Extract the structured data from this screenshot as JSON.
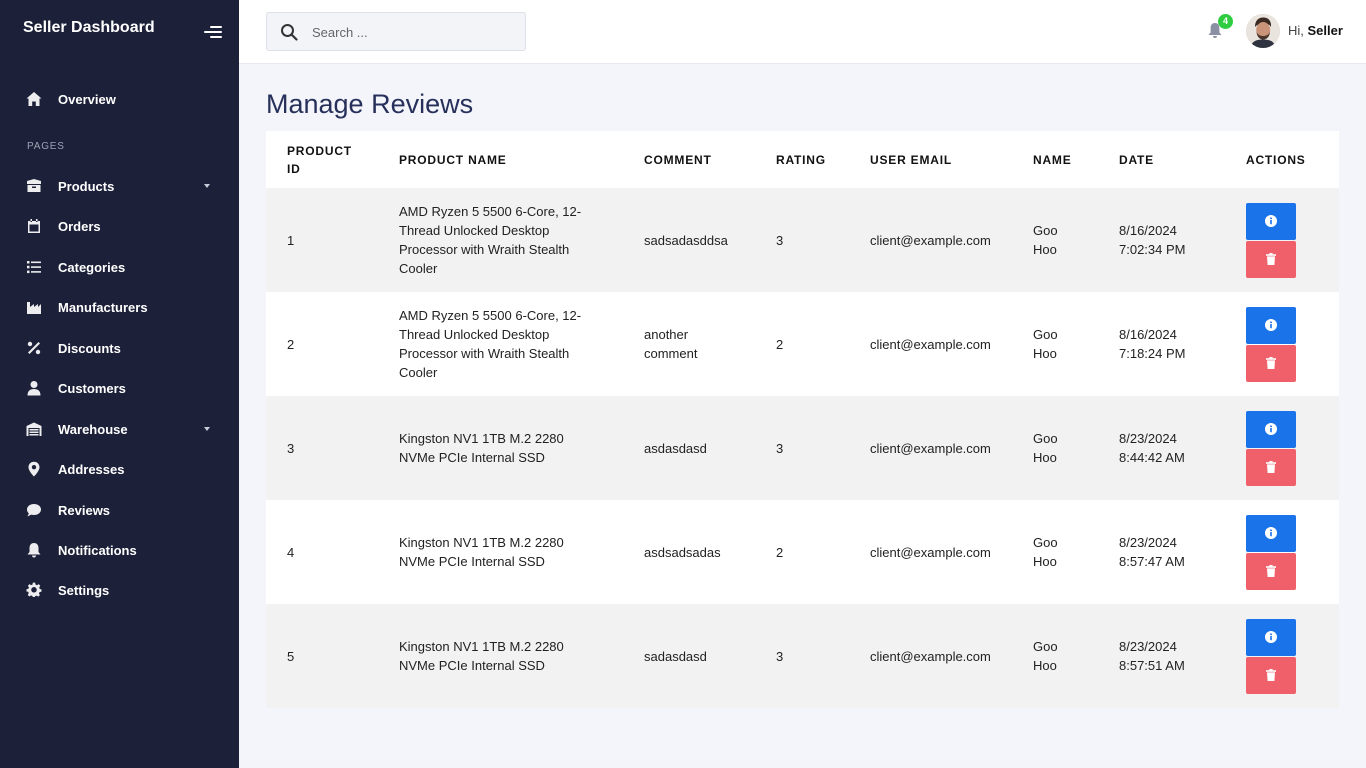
{
  "sidebar": {
    "brand": "Seller Dashboard",
    "overview": "Overview",
    "section_label": "PAGES",
    "items": [
      {
        "label": "Products"
      },
      {
        "label": "Orders"
      },
      {
        "label": "Categories"
      },
      {
        "label": "Manufacturers"
      },
      {
        "label": "Discounts"
      },
      {
        "label": "Customers"
      },
      {
        "label": "Warehouse"
      },
      {
        "label": "Addresses"
      },
      {
        "label": "Reviews"
      },
      {
        "label": "Notifications"
      },
      {
        "label": "Settings"
      }
    ]
  },
  "header": {
    "search_placeholder": "Search ...",
    "notification_count": "4",
    "greeting_prefix": "Hi,",
    "user_name": "Seller"
  },
  "page": {
    "title": "Manage Reviews"
  },
  "table": {
    "columns": [
      "PRODUCT ID",
      "PRODUCT NAME",
      "COMMENT",
      "RATING",
      "USER EMAIL",
      "NAME",
      "DATE",
      "ACTIONS"
    ],
    "rows": [
      {
        "id": "1",
        "product": "AMD Ryzen 5 5500 6-Core, 12-Thread Unlocked Desktop Processor with Wraith Stealth Cooler",
        "comment": "sadsadasddsa",
        "rating": "3",
        "email": "client@example.com",
        "name": "Goo Hoo",
        "date": "8/16/2024 7:02:34 PM"
      },
      {
        "id": "2",
        "product": "AMD Ryzen 5 5500 6-Core, 12-Thread Unlocked Desktop Processor with Wraith Stealth Cooler",
        "comment": "another comment",
        "rating": "2",
        "email": "client@example.com",
        "name": "Goo Hoo",
        "date": "8/16/2024 7:18:24 PM"
      },
      {
        "id": "3",
        "product": "Kingston NV1 1TB M.2 2280 NVMe PCIe Internal SSD",
        "comment": "asdasdasd",
        "rating": "3",
        "email": "client@example.com",
        "name": "Goo Hoo",
        "date": "8/23/2024 8:44:42 AM"
      },
      {
        "id": "4",
        "product": "Kingston NV1 1TB M.2 2280 NVMe PCIe Internal SSD",
        "comment": "asdsadsadas",
        "rating": "2",
        "email": "client@example.com",
        "name": "Goo Hoo",
        "date": "8/23/2024 8:57:47 AM"
      },
      {
        "id": "5",
        "product": "Kingston NV1 1TB M.2 2280 NVMe PCIe Internal SSD",
        "comment": "sadasdasd",
        "rating": "3",
        "email": "client@example.com",
        "name": "Goo Hoo",
        "date": "8/23/2024 8:57:51 AM"
      }
    ]
  },
  "colors": {
    "sidebar_bg": "#1c2038",
    "info_button": "#1a73e8",
    "delete_button": "#f0606b",
    "title": "#26305a",
    "badge": "#2ecc40"
  }
}
